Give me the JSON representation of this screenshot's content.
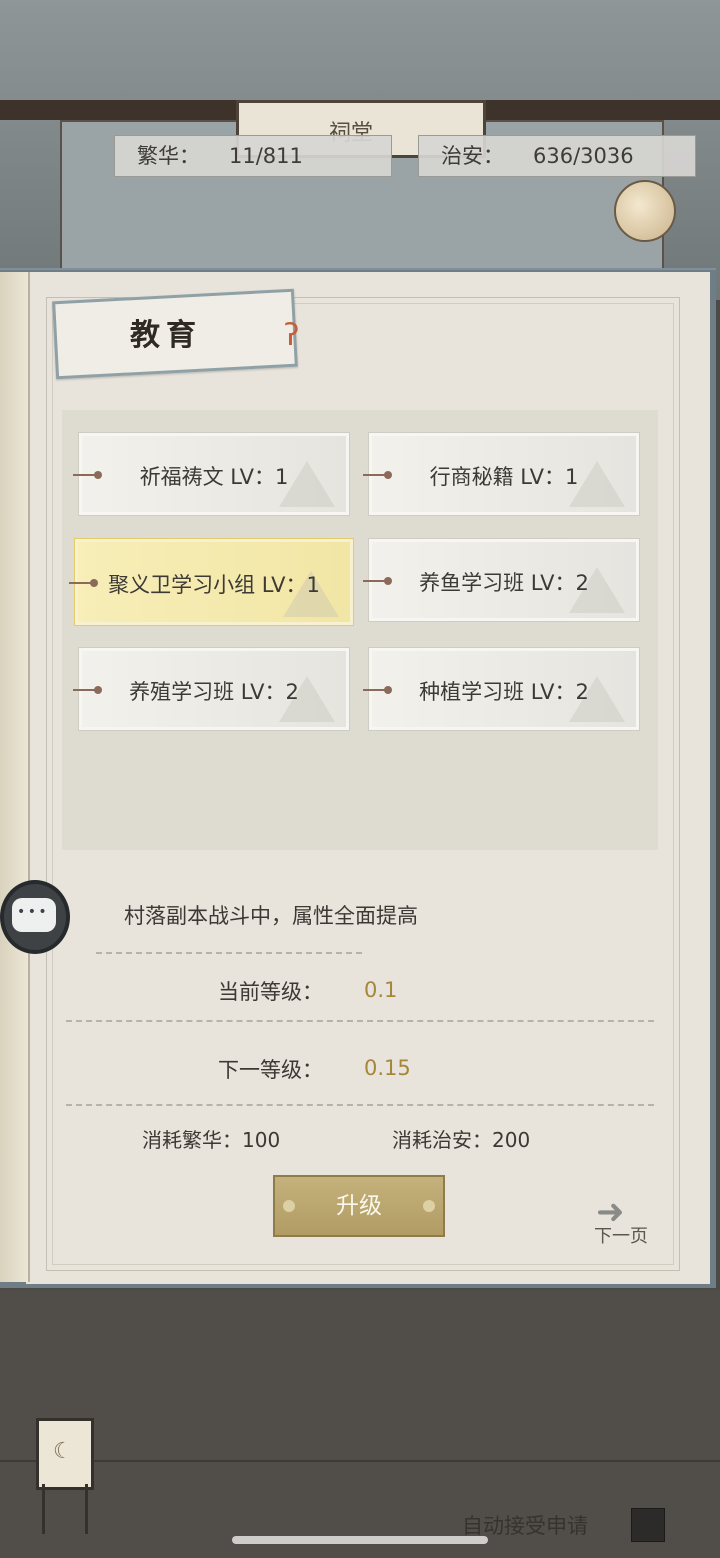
{
  "header": {
    "sign_text": "祠堂",
    "prosperity": {
      "label": "繁华：",
      "value": "11/811"
    },
    "security": {
      "label": "治安：",
      "value": "636/3036"
    }
  },
  "panel": {
    "title": "教育",
    "skills": [
      {
        "label": "祈福祷文 LV：1",
        "active": false
      },
      {
        "label": "行商秘籍 LV：1",
        "active": false
      },
      {
        "label": "聚义卫学习小组 LV：1",
        "active": true
      },
      {
        "label": "养鱼学习班 LV：2",
        "active": false
      },
      {
        "label": "养殖学习班 LV：2",
        "active": false
      },
      {
        "label": "种植学习班 LV：2",
        "active": false
      }
    ],
    "description": "村落副本战斗中，属性全面提高",
    "current_level": {
      "label": "当前等级：",
      "value": "0.1"
    },
    "next_level": {
      "label": "下一等级：",
      "value": "0.15"
    },
    "cost_prosperity": {
      "label": "消耗繁华：",
      "value": "100"
    },
    "cost_security": {
      "label": "消耗治安：",
      "value": "200"
    },
    "upgrade_label": "升级",
    "next_page_label": "下一页"
  },
  "footer": {
    "auto_accept_label": "自动接受申请"
  },
  "colors": {
    "accent_gold": "#a6863a",
    "button": "#b9a46d",
    "active_card": "#f4e9ad"
  }
}
